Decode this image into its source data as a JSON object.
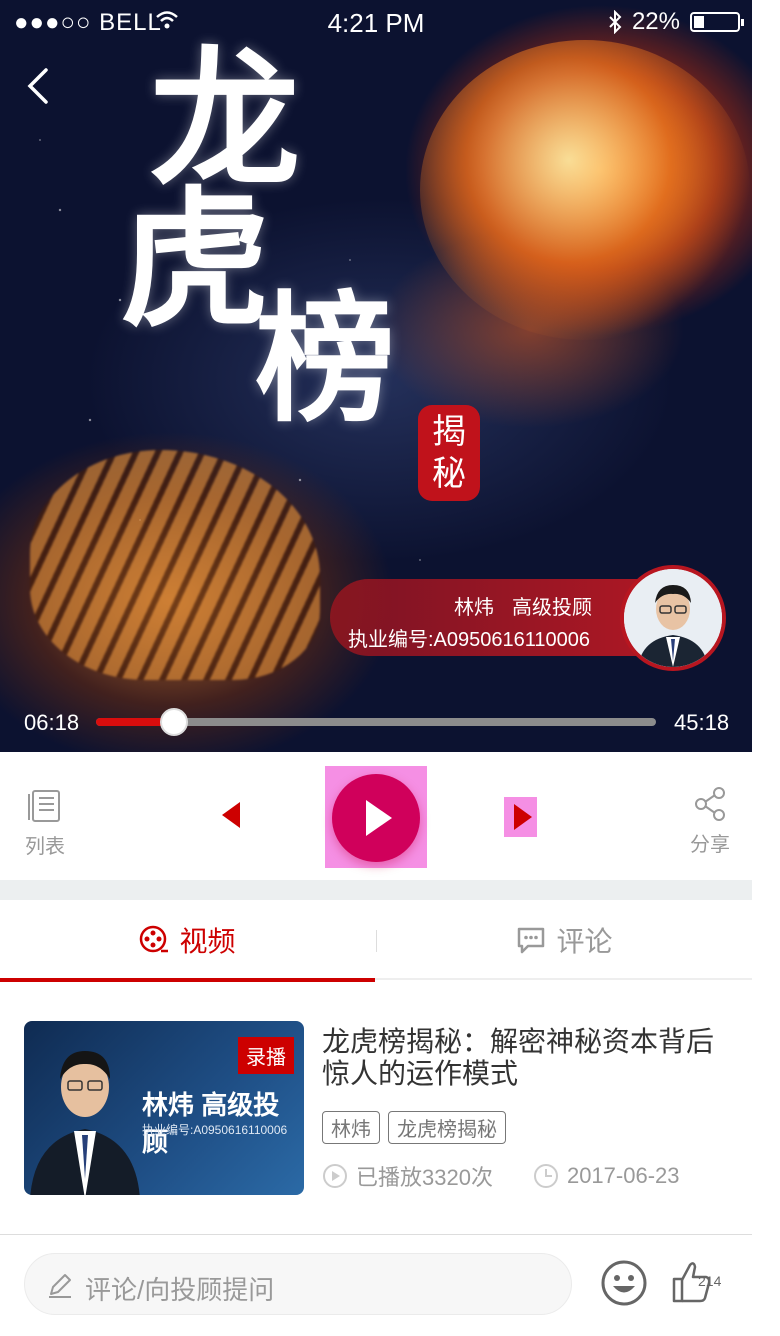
{
  "status_bar": {
    "carrier": "●●●○○ BELL",
    "time": "4:21 PM",
    "battery": "22%"
  },
  "player": {
    "poster_title_chars": [
      "龙",
      "虎",
      "榜"
    ],
    "seal_text": [
      "揭",
      "秘"
    ],
    "advisor_name": "林炜",
    "advisor_role": "高级投顾",
    "license": "执业编号:A0950616110006",
    "current_time": "06:18",
    "total_time": "45:18",
    "progress": 0.14
  },
  "controls": {
    "list_label": "列表",
    "share_label": "分享"
  },
  "tabs": [
    {
      "label": "视频"
    },
    {
      "label": "评论"
    }
  ],
  "video": {
    "thumb_badge": "录播",
    "thumb_name": "林炜 高级投顾",
    "thumb_license": "执业编号:A0950616110006",
    "title": "龙虎榜揭秘：解密神秘资本背后惊人的运作模式",
    "tags": [
      "林炜",
      "龙虎榜揭秘"
    ],
    "plays": "已播放3320次",
    "date": "2017-06-23"
  },
  "bottom": {
    "placeholder": "评论/向投顾提问",
    "like_count": "214"
  },
  "colors": {
    "accent": "#cd0000",
    "text_primary": "#333333",
    "text_secondary": "#999999",
    "tag": "#777777",
    "divider": "#eeeeee"
  }
}
